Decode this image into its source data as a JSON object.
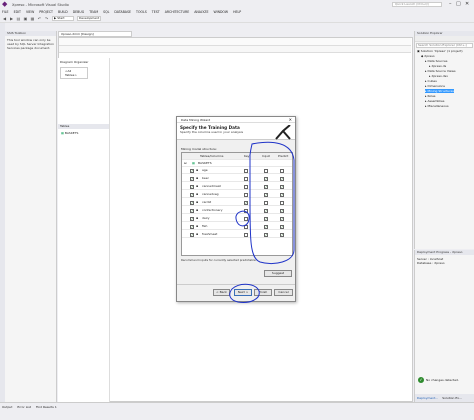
{
  "window": {
    "title": "Xpreso - Microsoft Visual Studio",
    "quick_launch": "Quick Launch (Ctrl+Q)",
    "min": "–",
    "max": "□",
    "close": "✕"
  },
  "menu": [
    "FILE",
    "EDIT",
    "VIEW",
    "PROJECT",
    "BUILD",
    "DEBUG",
    "TEAM",
    "SQL",
    "DATABASE",
    "TOOLS",
    "TEST",
    "ARCHITECTURE",
    "ANALYZE",
    "WINDOW",
    "HELP"
  ],
  "toolbar": {
    "start_label": "▶ Start",
    "config": "Development"
  },
  "ssis_toolbox": {
    "title": "SSIS Toolbox",
    "message": "This tool window can only be used by SQL Server Integration Services package document."
  },
  "document": {
    "tab": "Xpreso.dmm [Design]",
    "diagram_organizer": "Diagram Organizer",
    "all_tables": "<All Tables>",
    "tables_label": "Tables",
    "table_item": "BASKETS"
  },
  "solution_explorer": {
    "title": "Solution Explorer",
    "search": "Search Solution Explorer (Ctrl+;)",
    "items": [
      {
        "label": "Solution 'Xpreso' (1 project)",
        "indent": 0
      },
      {
        "label": "Xpreso",
        "indent": 1
      },
      {
        "label": "Data Sources",
        "indent": 2
      },
      {
        "label": "Xpreso.ds",
        "indent": 3
      },
      {
        "label": "Data Source Views",
        "indent": 2
      },
      {
        "label": "Xpreso.dsv",
        "indent": 3
      },
      {
        "label": "Cubes",
        "indent": 2
      },
      {
        "label": "Dimensions",
        "indent": 2
      },
      {
        "label": "Mining Structures",
        "indent": 2,
        "selected": true
      },
      {
        "label": "Roles",
        "indent": 2
      },
      {
        "label": "Assemblies",
        "indent": 2
      },
      {
        "label": "Miscellaneous",
        "indent": 2
      }
    ]
  },
  "properties": {
    "title": "Deployment Progress - Xpreso",
    "server": "Server : localhost",
    "database": "Database : Xpreso",
    "status": "No changes detected.",
    "footer_tabs": [
      "Deployment...",
      "Solution Ex..."
    ]
  },
  "status_bar": {
    "tabs": [
      "Output",
      "Error List",
      "Find Results 1"
    ]
  },
  "wizard": {
    "title": "Data Mining Wizard",
    "heading": "Specify the Training Data",
    "subheading": "Specify the columns used in your analysis",
    "grid_label": "Mining model structure:",
    "col_tables": "Tables/Columns",
    "col_key": "Key",
    "col_input": "Input",
    "col_predict": "Predict",
    "table_name": "BASKETS",
    "rows": [
      {
        "name": "age",
        "checked": true,
        "key": false,
        "input": false,
        "predict": false
      },
      {
        "name": "beer",
        "checked": true,
        "key": false,
        "input": true,
        "predict": true
      },
      {
        "name": "cannedmeat",
        "checked": true,
        "key": false,
        "input": true,
        "predict": true
      },
      {
        "name": "cannedveg",
        "checked": true,
        "key": false,
        "input": true,
        "predict": true
      },
      {
        "name": "cardid",
        "checked": true,
        "key": true,
        "input": false,
        "predict": false
      },
      {
        "name": "confectionery",
        "checked": true,
        "key": false,
        "input": true,
        "predict": true
      },
      {
        "name": "dairy",
        "checked": true,
        "key": false,
        "input": true,
        "predict": true
      },
      {
        "name": "fish",
        "checked": true,
        "key": false,
        "input": true,
        "predict": true
      },
      {
        "name": "freshmeat",
        "checked": true,
        "key": false,
        "input": true,
        "predict": true
      }
    ],
    "recommend_text": "Recommend inputs for currently selected predictable:",
    "suggest": "Suggest",
    "back": "< Back",
    "next": "Next >",
    "finish": "Finish",
    "cancel": "Cancel"
  }
}
